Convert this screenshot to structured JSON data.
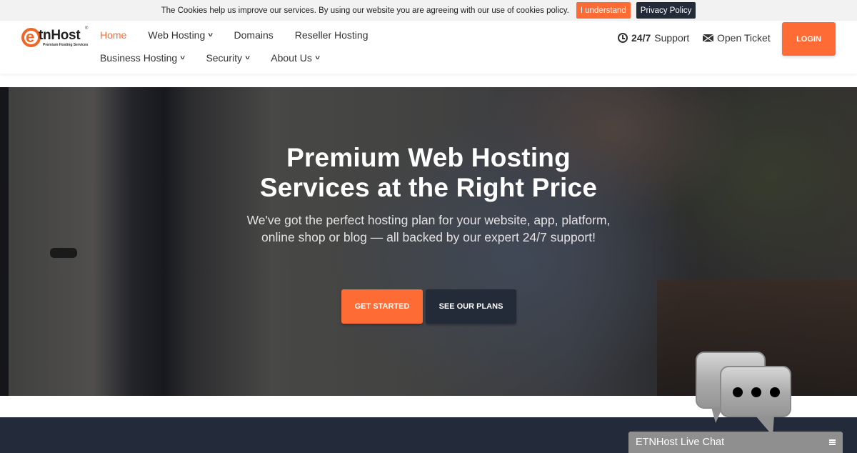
{
  "cookie_bar": {
    "message": "The Cookies help us improve our services. By using our website you are agreeing with our use of cookies policy.",
    "accept_label": "I understand",
    "policy_label": "Privacy Policy"
  },
  "header": {
    "logo": {
      "letter": "e",
      "name": "tnHost",
      "tagline": "Premium Hosting Services",
      "reg": "®"
    },
    "nav_row1": [
      {
        "label": "Home",
        "active": true,
        "dropdown": false
      },
      {
        "label": "Web Hosting",
        "active": false,
        "dropdown": true
      },
      {
        "label": "Domains",
        "active": false,
        "dropdown": false
      },
      {
        "label": "Reseller Hosting",
        "active": false,
        "dropdown": false
      }
    ],
    "nav_row2": [
      {
        "label": "Business Hosting",
        "active": false,
        "dropdown": true
      },
      {
        "label": "Security",
        "active": false,
        "dropdown": true
      },
      {
        "label": "About Us",
        "active": false,
        "dropdown": true
      }
    ],
    "support_bold": "24/7",
    "support_label": "Support",
    "ticket_label": "Open Ticket",
    "login_label": "LOGIN",
    "chevron": "⌄"
  },
  "hero": {
    "title_line1": "Premium Web Hosting",
    "title_line2": "Services at the Right Price",
    "subtitle_line1": "We've got the perfect hosting plan for your website, app, platform,",
    "subtitle_line2": "online shop or blog — all backed by our expert 24/7 support!",
    "primary_button": "GET STARTED",
    "secondary_button": "SEE OUR PLANS"
  },
  "chat": {
    "title": "ETNHost Live Chat"
  },
  "colors": {
    "accent": "#ff6b35",
    "dark": "#232a38",
    "band": "#232a3a",
    "chat_bar": "#8f8f8f"
  }
}
